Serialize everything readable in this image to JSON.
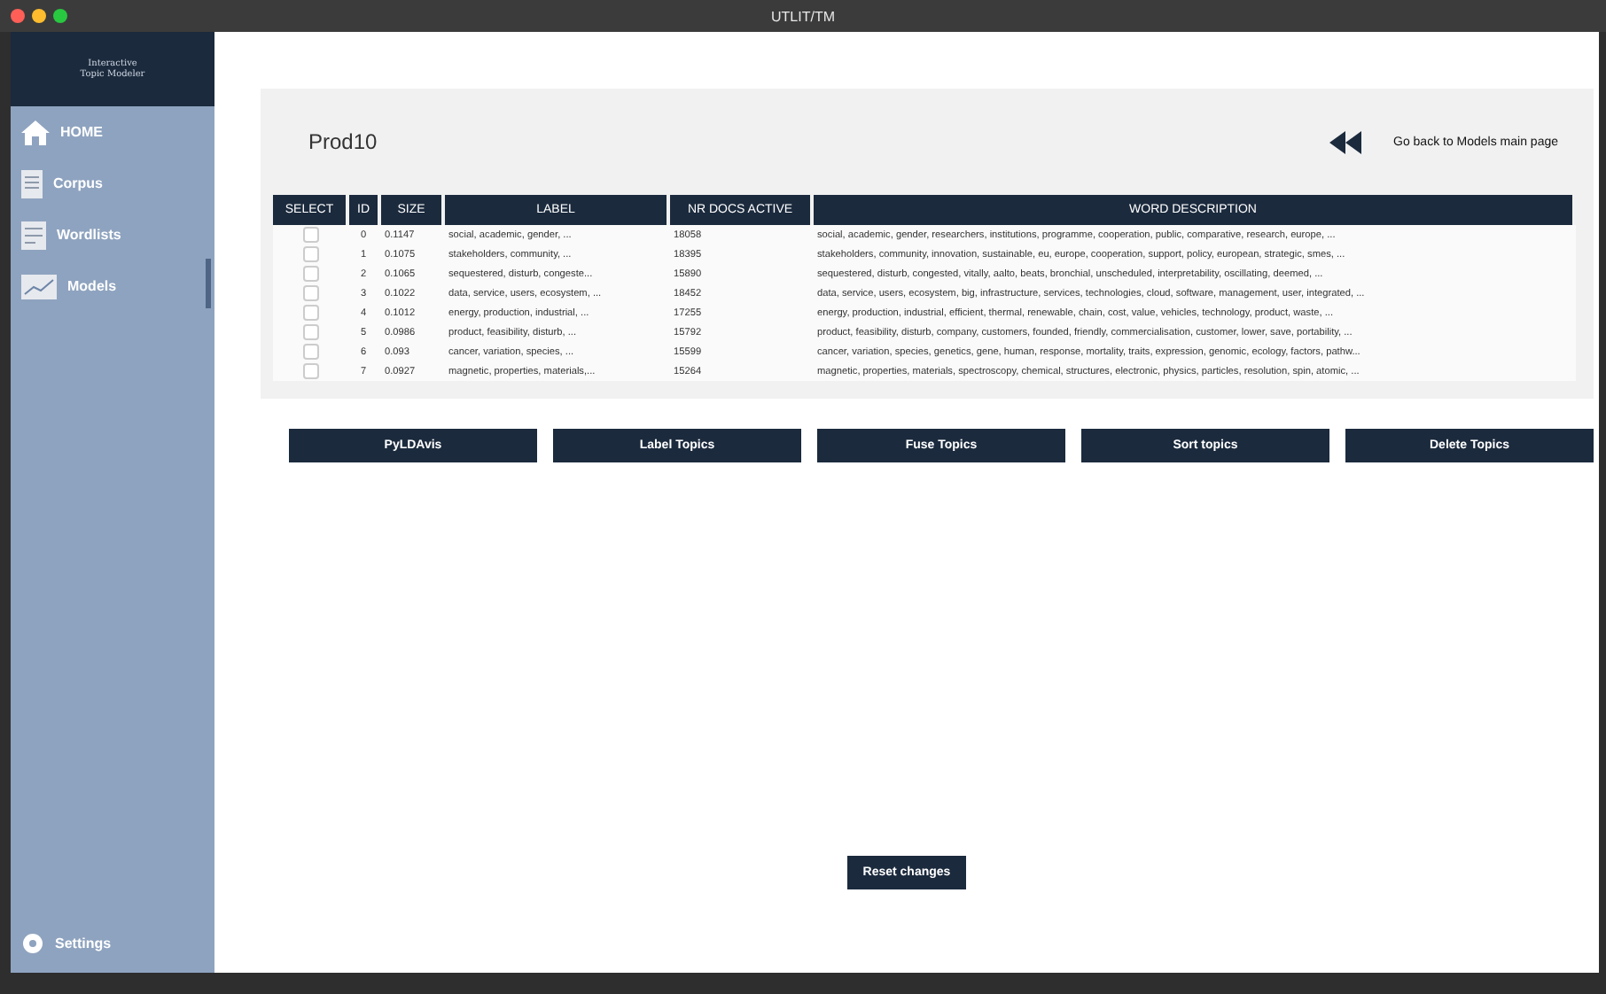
{
  "window": {
    "title": "UTLIT/TM"
  },
  "logo": {
    "lines": [
      "Interactive",
      "Topic Modeler"
    ]
  },
  "sidebar": {
    "items": [
      {
        "kind": "home",
        "label": "HOME"
      },
      {
        "kind": "corpus",
        "label": "Corpus"
      },
      {
        "kind": "wordlists",
        "label": "Wordlists"
      },
      {
        "kind": "models",
        "label": "Models"
      }
    ],
    "footer": {
      "kind": "settings",
      "label": "Settings"
    }
  },
  "model_name": "Prod10",
  "back_link": "Go back to Models main page",
  "table": {
    "columns": [
      "SELECT",
      "ID",
      "SIZE",
      "LABEL",
      "NR DOCS ACTIVE",
      "WORD DESCRIPTION"
    ],
    "rows": [
      {
        "checked": false,
        "id": "0",
        "size": "0.1147",
        "label": "social, academic, gender, ...",
        "docs": "18058",
        "words": "social, academic, gender, researchers, institutions, programme, cooperation, public, comparative, research, europe, ..."
      },
      {
        "checked": false,
        "id": "1",
        "size": "0.1075",
        "label": "stakeholders, community, ...",
        "docs": "18395",
        "words": "stakeholders, community, innovation, sustainable, eu, europe, cooperation, support, policy, european, strategic, smes, ..."
      },
      {
        "checked": false,
        "id": "2",
        "size": "0.1065",
        "label": "sequestered, disturb, congeste...",
        "docs": "15890",
        "words": "sequestered, disturb, congested, vitally, aalto, beats, bronchial, unscheduled, interpretability, oscillating, deemed, ..."
      },
      {
        "checked": false,
        "id": "3",
        "size": "0.1022",
        "label": "data, service, users, ecosystem, ...",
        "docs": "18452",
        "words": "data, service, users, ecosystem, big, infrastructure, services, technologies, cloud, software, management, user, integrated, ..."
      },
      {
        "checked": false,
        "id": "4",
        "size": "0.1012",
        "label": "energy, production, industrial, ...",
        "docs": "17255",
        "words": "energy, production, industrial, efficient, thermal, renewable, chain, cost, value, vehicles, technology, product, waste, ..."
      },
      {
        "checked": false,
        "id": "5",
        "size": "0.0986",
        "label": "product, feasibility, disturb, ...",
        "docs": "15792",
        "words": "product, feasibility, disturb, company, customers, founded, friendly, commercialisation, customer, lower, save, portability, ..."
      },
      {
        "checked": false,
        "id": "6",
        "size": "0.093",
        "label": "cancer, variation, species, ...",
        "docs": "15599",
        "words": "cancer, variation, species, genetics, gene, human, response, mortality, traits, expression, genomic, ecology, factors, pathw..."
      },
      {
        "checked": false,
        "id": "7",
        "size": "0.0927",
        "label": "magnetic, properties, materials,...",
        "docs": "15264",
        "words": "magnetic, properties, materials, spectroscopy, chemical, structures, electronic, physics, particles, resolution, spin, atomic, ..."
      }
    ]
  },
  "actions": [
    "PyLDAvis",
    "Label Topics",
    "Fuse Topics",
    "Sort topics",
    "Delete Topics"
  ],
  "reset_button": "Reset changes"
}
